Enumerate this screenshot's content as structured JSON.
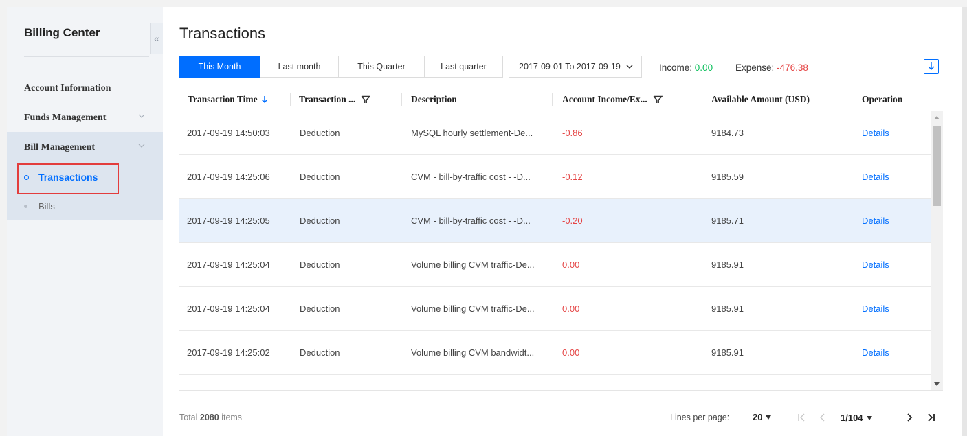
{
  "sidebar": {
    "title": "Billing Center",
    "collapse_glyph": "«",
    "items": [
      {
        "label": "Account Information"
      },
      {
        "label": "Funds Management"
      },
      {
        "label": "Bill Management"
      }
    ],
    "subitems": [
      {
        "label": "Transactions",
        "active": true
      },
      {
        "label": "Bills",
        "active": false
      }
    ]
  },
  "main": {
    "title": "Transactions",
    "tabs": [
      "This Month",
      "Last month",
      "This Quarter",
      "Last quarter"
    ],
    "date_range": "2017-09-01 To 2017-09-19",
    "income_label": "Income:",
    "income_value": "0.00",
    "expense_label": "Expense:",
    "expense_value": "-476.38",
    "download_icon": "download-icon"
  },
  "table": {
    "columns": [
      "Transaction Time",
      "Transaction ...",
      "Description",
      "Account Income/Ex...",
      "Available Amount (USD)",
      "Operation"
    ],
    "rows": [
      [
        "2017-09-19 14:50:03",
        "Deduction",
        "MySQL hourly settlement-De...",
        "-0.86",
        "9184.73",
        "Details"
      ],
      [
        "2017-09-19 14:25:06",
        "Deduction",
        "CVM - bill-by-traffic cost - -D...",
        "-0.12",
        "9185.59",
        "Details"
      ],
      [
        "2017-09-19 14:25:05",
        "Deduction",
        "CVM - bill-by-traffic cost - -D...",
        "-0.20",
        "9185.71",
        "Details"
      ],
      [
        "2017-09-19 14:25:04",
        "Deduction",
        "Volume billing CVM traffic-De...",
        "0.00",
        "9185.91",
        "Details"
      ],
      [
        "2017-09-19 14:25:04",
        "Deduction",
        "Volume billing CVM traffic-De...",
        "0.00",
        "9185.91",
        "Details"
      ],
      [
        "2017-09-19 14:25:02",
        "Deduction",
        "Volume billing CVM bandwidt...",
        "0.00",
        "9185.91",
        "Details"
      ]
    ],
    "highlighted_row": 2
  },
  "footer": {
    "total_prefix": "Total",
    "total_count": "2080",
    "total_suffix": "items",
    "lines_per_page_label": "Lines per page:",
    "lines_per_page_value": "20",
    "page_value": "1/104"
  }
}
